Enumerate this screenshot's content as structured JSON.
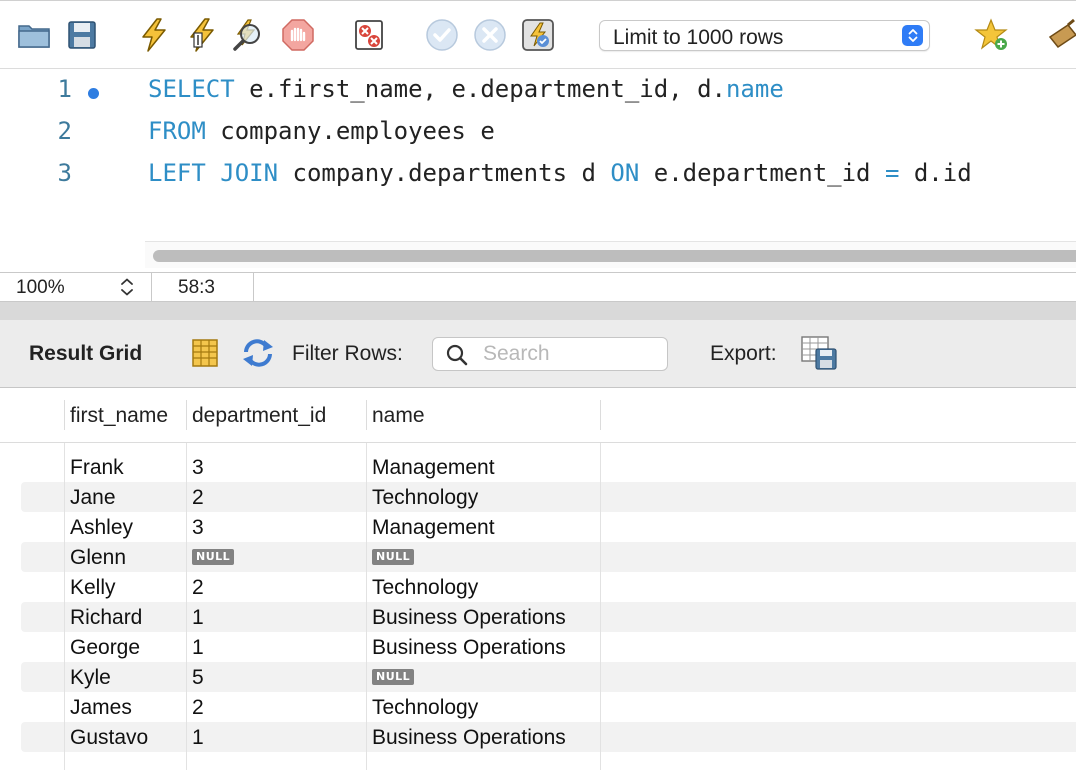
{
  "toolbar": {
    "icons": [
      "open-folder-icon",
      "save-icon",
      "execute-icon",
      "execute-current-icon",
      "explain-icon",
      "stop-icon",
      "toggle-error-icon",
      "commit-icon",
      "rollback-icon",
      "autocommit-icon",
      "add-snippet-icon",
      "beautify-icon"
    ],
    "limit_select": {
      "value": "Limit to 1000 rows"
    }
  },
  "editor": {
    "lines": [
      {
        "number": "1",
        "tokens": [
          {
            "t": "SELECT",
            "kw": true
          },
          {
            "t": " e.first_name, e.department_id, d."
          },
          {
            "t": "name",
            "kw": true
          }
        ]
      },
      {
        "number": "2",
        "tokens": [
          {
            "t": "FROM",
            "kw": true
          },
          {
            "t": " company.employees e"
          }
        ]
      },
      {
        "number": "3",
        "tokens": [
          {
            "t": "LEFT JOIN",
            "kw": true
          },
          {
            "t": " company.departments d "
          },
          {
            "t": "ON",
            "kw": true
          },
          {
            "t": " e.department_id "
          },
          {
            "t": "=",
            "kw": true
          },
          {
            "t": " d.id"
          }
        ]
      }
    ]
  },
  "status": {
    "zoom": "100%",
    "cursor": "58:3"
  },
  "result": {
    "title": "Result Grid",
    "filter_label": "Filter Rows:",
    "search_placeholder": "Search",
    "export_label": "Export:",
    "columns": [
      "first_name",
      "department_id",
      "name"
    ],
    "rows": [
      [
        "Frank",
        "3",
        "Management"
      ],
      [
        "Jane",
        "2",
        "Technology"
      ],
      [
        "Ashley",
        "3",
        "Management"
      ],
      [
        "Glenn",
        "NULL",
        "NULL"
      ],
      [
        "Kelly",
        "2",
        "Technology"
      ],
      [
        "Richard",
        "1",
        "Business Operations"
      ],
      [
        "George",
        "1",
        "Business Operations"
      ],
      [
        "Kyle",
        "5",
        "NULL"
      ],
      [
        "James",
        "2",
        "Technology"
      ],
      [
        "Gustavo",
        "1",
        "Business Operations"
      ]
    ]
  },
  "colors": {
    "keyword": "#2e8ec6",
    "line_number": "#3d7a9c",
    "accent": "#2f7cf6",
    "null_badge": "#828282"
  }
}
